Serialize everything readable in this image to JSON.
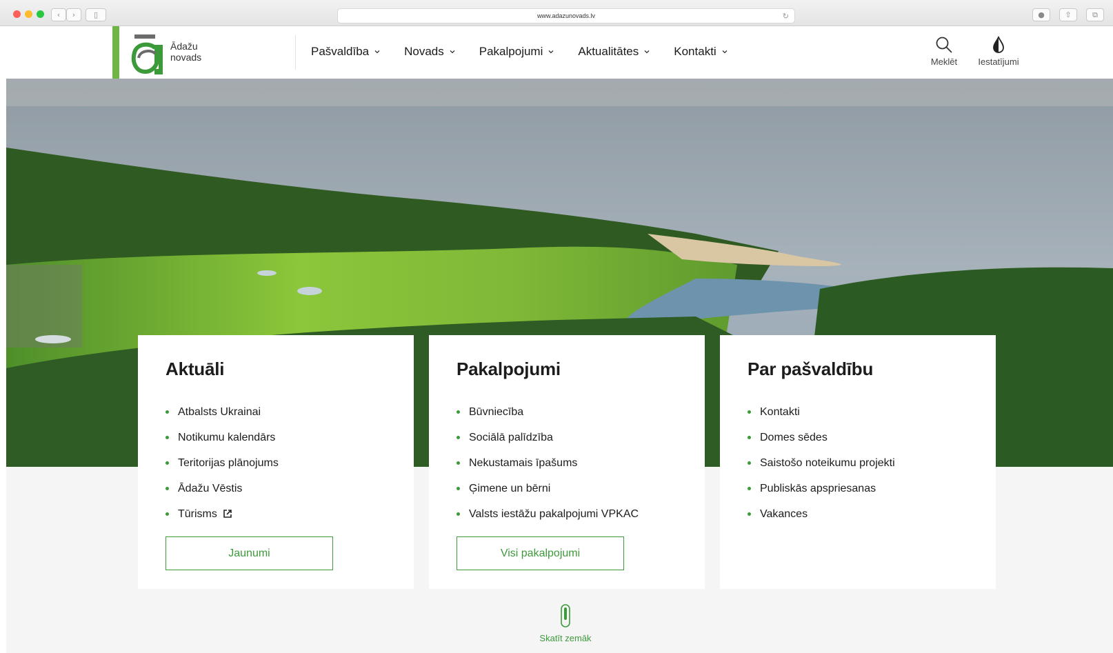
{
  "browser": {
    "url": "www.adazunovads.lv",
    "icons": [
      "back-icon",
      "forward-icon",
      "sidebar-icon",
      "reload-icon",
      "download-icon",
      "share-icon",
      "tabs-icon"
    ]
  },
  "header": {
    "logo": {
      "line1": "Ādažu",
      "line2": "novads",
      "accent": "#6fb543"
    },
    "nav": [
      {
        "label": "Pašvaldība"
      },
      {
        "label": "Novads"
      },
      {
        "label": "Pakalpojumi"
      },
      {
        "label": "Aktualitātes"
      },
      {
        "label": "Kontakti"
      }
    ],
    "search_label": "Meklēt",
    "settings_label": "Iestatījumi"
  },
  "cards": [
    {
      "title": "Aktuāli",
      "items": [
        "Atbalsts Ukrainai",
        "Notikumu kalendārs",
        "Teritorijas plānojums",
        "Ādažu Vēstis",
        "Tūrisms"
      ],
      "button": "Jaunumi"
    },
    {
      "title": "Pakalpojumi",
      "items": [
        "Būvniecība",
        "Sociālā palīdzība",
        "Nekustamais īpašums",
        "Ģimene un bērni",
        "Valsts iestāžu pakalpojumi VPKAC"
      ],
      "button": "Visi pakalpojumi"
    },
    {
      "title": "Par pašvaldību",
      "items": [
        "Kontakti",
        "Domes sēdes",
        "Saistošo noteikumu projekti",
        "Publiskās apspriesanas",
        "Vakances"
      ]
    }
  ],
  "scroll_hint": "Skatīt zemāk",
  "colors": {
    "brand_green": "#3c9a3a",
    "accent_green": "#6fb543",
    "background": "#f5f5f5"
  }
}
